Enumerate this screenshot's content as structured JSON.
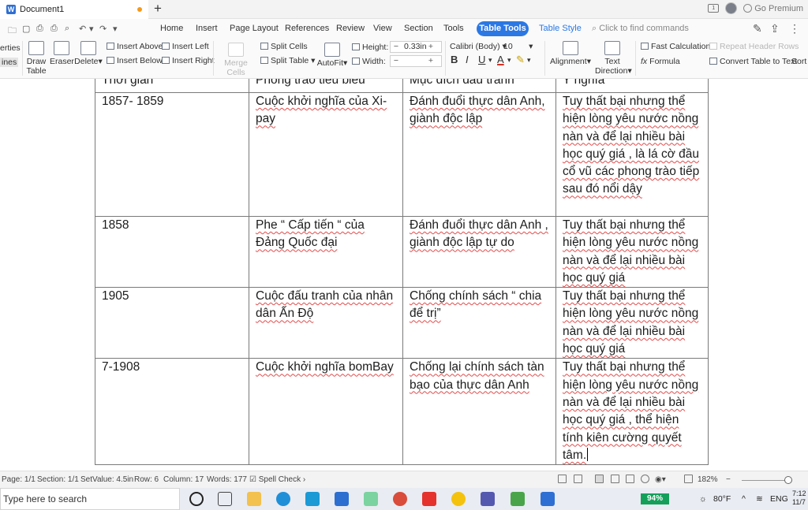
{
  "app": {
    "doc_title": "Document1",
    "new_tab": "+",
    "premium": "Go Premium",
    "brand_color": "#2b78e4"
  },
  "menu": {
    "items": [
      "Home",
      "Insert",
      "Page Layout",
      "References",
      "Review",
      "View",
      "Section",
      "Tools"
    ],
    "active_tab": "Table Tools",
    "table_style": "Table Style",
    "find_placeholder": "Click to find commands"
  },
  "ribbon": {
    "properties": "erties",
    "gridlines": "ines",
    "draw_table": "Draw Table",
    "eraser": "Eraser",
    "delete": "Delete",
    "insert_above": "Insert Above",
    "insert_below": "Insert Below",
    "insert_left": "Insert Left",
    "insert_right": "Insert Right",
    "merge_cells": "Merge Cells",
    "split_cells": "Split Cells",
    "split_table": "Split Table",
    "autofit": "AutoFit",
    "height_label": "Height:",
    "height_value": "0.33in",
    "width_label": "Width:",
    "width_value": "",
    "font_name": "Calibri (Body)",
    "font_size": "10",
    "alignment": "Alignment",
    "text_direction": "Text Direction",
    "fast_calculation": "Fast Calculation",
    "formula": "Formula",
    "repeat_header_rows": "Repeat Header Rows",
    "convert_table": "Convert Table to Text",
    "sort": "Sort"
  },
  "table": {
    "header": [
      "Thời gian",
      "Phong trào tiêu biểu",
      "Mục đích đấu tranh",
      "Ý nghĩa"
    ],
    "rows": [
      [
        "1857- 1859",
        " Cuộc khởi nghĩa của Xi-pay",
        "Đánh đuổi thực dân Anh, giành độc lập",
        "Tuy thất bại nhưng thể hiện lòng yêu nước nồng nàn và để lại nhiều bài học quý giá , là lá cờ đầu cổ vũ các phong trào tiếp sau đó nổi dậy"
      ],
      [
        "1858",
        "Phe “ Cấp tiến “ của Đảng Quốc đại",
        "Đánh đuổi thực dân Anh , giành độc lập tự do",
        "Tuy thất bại nhưng thể hiện lòng yêu nước nồng nàn và để lại nhiều bài học quý giá"
      ],
      [
        "1905",
        "Cuộc đấu tranh của nhân dân Ấn Độ",
        "Chống chính sách “ chia để trị”",
        "Tuy thất bại nhưng thể hiện lòng yêu nước nồng nàn và để lại nhiều bài học quý giá"
      ],
      [
        "7-1908",
        "Cuộc khởi nghĩa bomBay",
        "Chống lại chính sách tàn bạo của thực dân Anh",
        "Tuy thất bại nhưng thể hiện lòng yêu nước nồng nàn và để lại nhiều bài học quý giá , thể hiện tính kiên cường quyết tâm."
      ]
    ]
  },
  "status": {
    "page": "Page: 1/1",
    "section": "Section: 1/1",
    "setvalue": "SetValue: 4.5in",
    "row": "Row: 6",
    "column": "Column: 17",
    "words": "Words: 177",
    "spell_check": "Spell Check",
    "zoom": "182%"
  },
  "taskbar": {
    "search_placeholder": "Type here to search",
    "battery": "94%",
    "temperature": "80°F",
    "language": "ENG",
    "time": "7:12",
    "date": "11/7"
  }
}
